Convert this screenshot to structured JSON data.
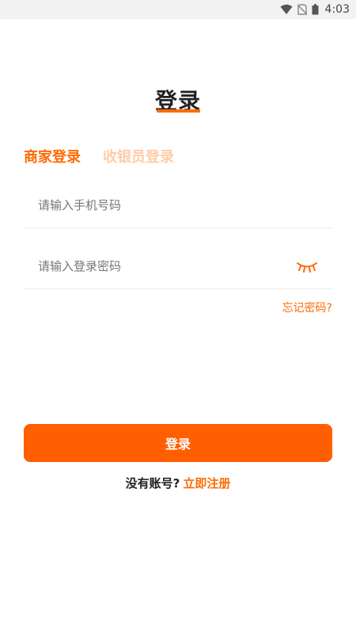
{
  "status_bar": {
    "time": "4:03",
    "icons": [
      "wifi-icon",
      "no-sim-icon",
      "battery-icon"
    ]
  },
  "page": {
    "title": "登录"
  },
  "tabs": [
    {
      "label": "商家登录",
      "active": true
    },
    {
      "label": "收银员登录",
      "active": false
    }
  ],
  "form": {
    "phone_placeholder": "请输入手机号码",
    "phone_value": "",
    "password_placeholder": "请输入登录密码",
    "password_value": "",
    "forgot_label": "忘记密码?",
    "submit_label": "登录"
  },
  "register": {
    "prompt": "没有账号?",
    "link_label": "立即注册"
  },
  "colors": {
    "accent": "#ff6a00",
    "button": "#ff5f00",
    "inactive_tab": "#ffcca8"
  }
}
